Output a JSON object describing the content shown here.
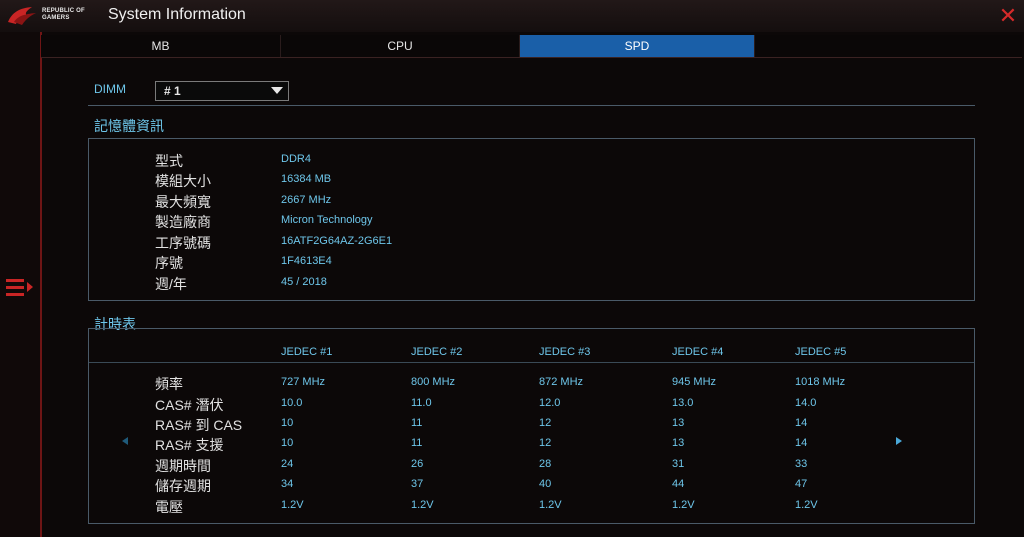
{
  "window": {
    "title": "System Information",
    "brand": "REPUBLIC OF\nGAMERS"
  },
  "tabs": [
    {
      "label": "MB",
      "active": false
    },
    {
      "label": "CPU",
      "active": false
    },
    {
      "label": "SPD",
      "active": true
    }
  ],
  "dimm": {
    "label": "DIMM",
    "selected": "# 1"
  },
  "memory_info": {
    "title": "記憶體資訊",
    "rows": [
      {
        "label": "型式",
        "value": "DDR4"
      },
      {
        "label": "模組大小",
        "value": "16384 MB"
      },
      {
        "label": "最大頻寬",
        "value": "2667 MHz"
      },
      {
        "label": "製造廠商",
        "value": "Micron Technology"
      },
      {
        "label": "工序號碼",
        "value": "16ATF2G64AZ-2G6E1"
      },
      {
        "label": "序號",
        "value": "1F4613E4"
      },
      {
        "label": "週/年",
        "value": "45 / 2018"
      }
    ]
  },
  "timing": {
    "title": "計時表",
    "columns": [
      "JEDEC #1",
      "JEDEC #2",
      "JEDEC #3",
      "JEDEC #4",
      "JEDEC #5"
    ],
    "rows": [
      {
        "label": "頻率",
        "values": [
          "727 MHz",
          "800 MHz",
          "872 MHz",
          "945 MHz",
          "1018 MHz"
        ]
      },
      {
        "label": "CAS# 潛伏",
        "values": [
          "10.0",
          "11.0",
          "12.0",
          "13.0",
          "14.0"
        ]
      },
      {
        "label": "RAS# 到 CAS",
        "values": [
          "10",
          "11",
          "12",
          "13",
          "14"
        ]
      },
      {
        "label": "RAS# 支援",
        "values": [
          "10",
          "11",
          "12",
          "13",
          "14"
        ]
      },
      {
        "label": "週期時間",
        "values": [
          "24",
          "26",
          "28",
          "31",
          "33"
        ]
      },
      {
        "label": "儲存週期",
        "values": [
          "34",
          "37",
          "40",
          "44",
          "47"
        ]
      },
      {
        "label": "電壓",
        "values": [
          "1.2V",
          "1.2V",
          "1.2V",
          "1.2V",
          "1.2V"
        ]
      }
    ]
  },
  "colors": {
    "accent_blue": "#1a5fa8",
    "value_cyan": "#6ec6ea",
    "rog_red": "#c92525"
  },
  "icons": {
    "close": "close-icon",
    "menu": "menu-icon",
    "prev": "arrow-left-icon",
    "next": "arrow-right-icon",
    "dropdown": "chevron-down-icon",
    "logo": "rog-logo-icon"
  }
}
